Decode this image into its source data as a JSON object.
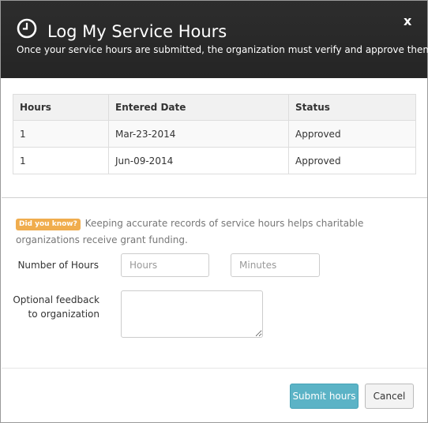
{
  "header": {
    "title": "Log My Service Hours",
    "subtitle": "Once your service hours are submitted, the organization must verify and approve them.",
    "close_label": "x"
  },
  "table": {
    "columns": [
      "Hours",
      "Entered Date",
      "Status"
    ],
    "rows": [
      {
        "hours": "1",
        "date": "Mar-23-2014",
        "status": "Approved"
      },
      {
        "hours": "1",
        "date": "Jun-09-2014",
        "status": "Approved"
      }
    ]
  },
  "tip": {
    "badge": "Did you know?",
    "text": "Keeping accurate records of service hours helps charitable organizations receive grant funding."
  },
  "form": {
    "hours_label": "Number of Hours",
    "hours_placeholder": "Hours",
    "minutes_placeholder": "Minutes",
    "feedback_label_line1": "Optional feedback",
    "feedback_label_line2": "to organization"
  },
  "footer": {
    "submit_label": "Submit hours",
    "cancel_label": "Cancel"
  },
  "icons": {
    "header": "clock-icon"
  },
  "colors": {
    "header_bg": "#2a2a2a",
    "badge": "#f0ad4e",
    "submit": "#5bb3c6"
  }
}
